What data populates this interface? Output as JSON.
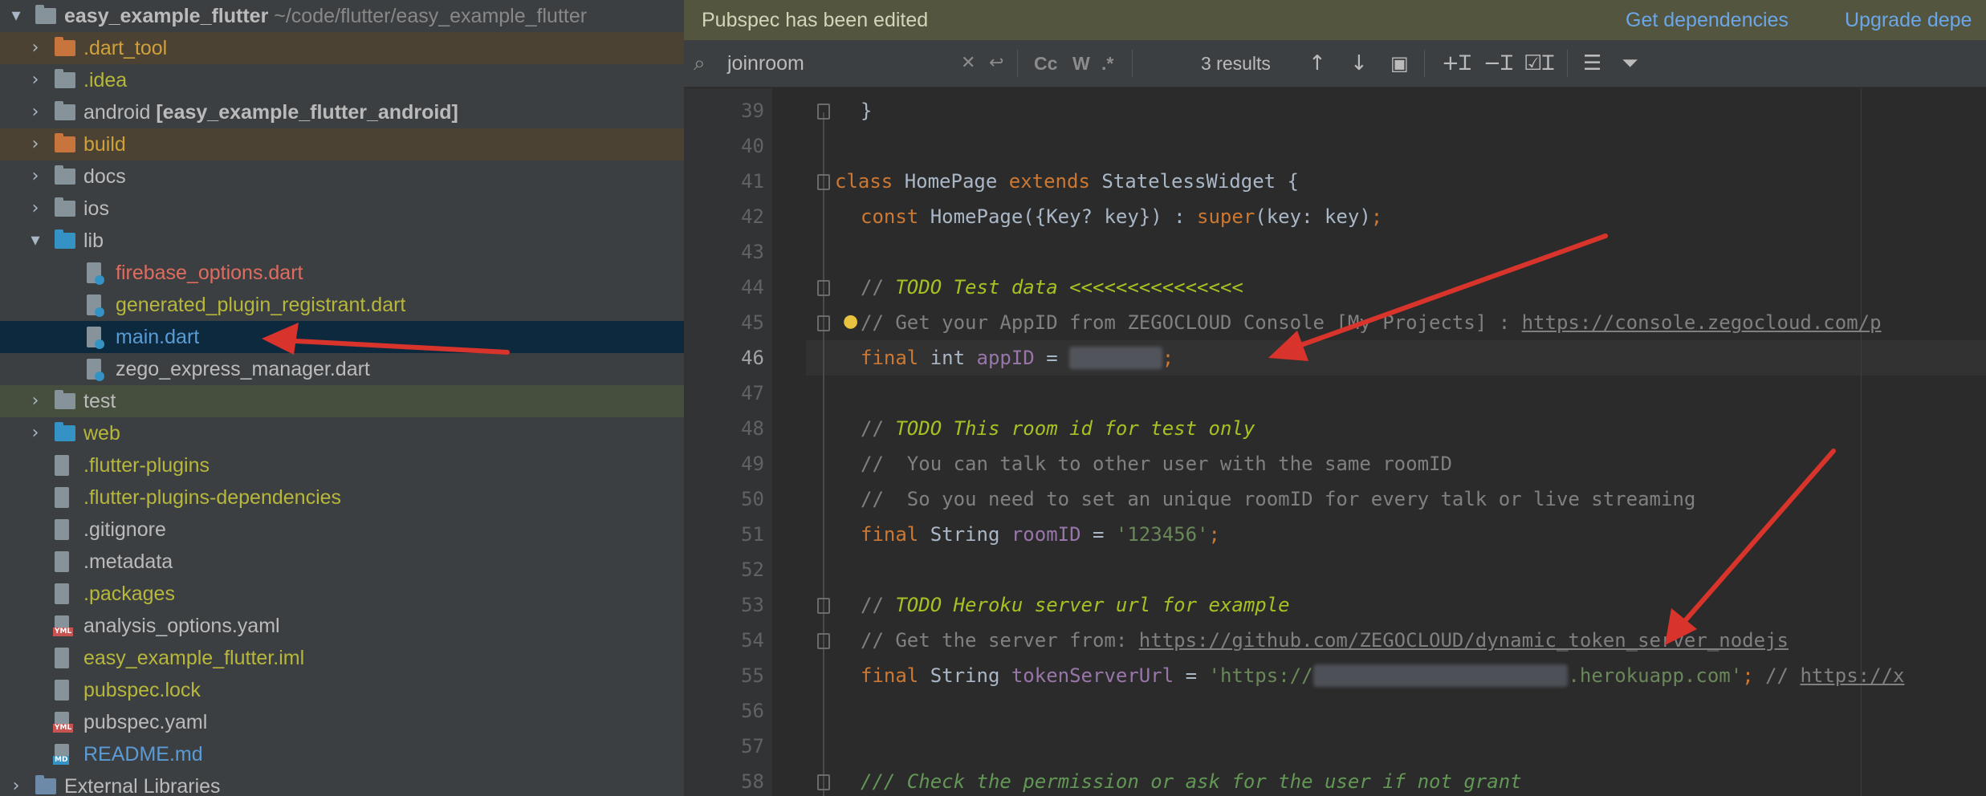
{
  "project_tree": {
    "items": [
      {
        "indent": 0,
        "arrow": "▾",
        "icon": "folder-icon",
        "label": "easy_example_flutter",
        "extra": "~/code/flutter/easy_example_flutter",
        "color": "white",
        "bold": true
      },
      {
        "indent": 1,
        "arrow": "›",
        "icon": "folder-icon",
        "label": ".dart_tool",
        "color": "orange",
        "bg": "brown"
      },
      {
        "indent": 1,
        "arrow": "›",
        "icon": "folder-icon",
        "label": ".idea",
        "color": "yellow"
      },
      {
        "indent": 1,
        "arrow": "›",
        "icon": "folder-icon",
        "label": "android",
        "extra": "[easy_example_flutter_android]",
        "color": "white"
      },
      {
        "indent": 1,
        "arrow": "›",
        "icon": "folder-icon",
        "label": "build",
        "color": "orange",
        "bg": "brown"
      },
      {
        "indent": 1,
        "arrow": "›",
        "icon": "folder-icon",
        "label": "docs",
        "color": "white"
      },
      {
        "indent": 1,
        "arrow": "›",
        "icon": "folder-icon",
        "label": "ios",
        "color": "white"
      },
      {
        "indent": 1,
        "arrow": "▾",
        "icon": "folder-icon",
        "label": "lib",
        "color": "white"
      },
      {
        "indent": 2,
        "icon": "dart-file-icon",
        "label": "firebase_options.dart",
        "color": "red"
      },
      {
        "indent": 2,
        "icon": "dart-file-icon",
        "label": "generated_plugin_registrant.dart",
        "color": "yellow"
      },
      {
        "indent": 2,
        "icon": "dart-file-icon",
        "label": "main.dart",
        "color": "blue",
        "selected": true
      },
      {
        "indent": 2,
        "icon": "dart-file-icon",
        "label": "zego_express_manager.dart",
        "color": "white"
      },
      {
        "indent": 1,
        "arrow": "›",
        "icon": "folder-icon",
        "label": "test",
        "color": "white",
        "bg": "green"
      },
      {
        "indent": 1,
        "arrow": "›",
        "icon": "folder-icon",
        "label": "web",
        "color": "yellow"
      },
      {
        "indent": 1,
        "icon": "file-icon",
        "label": ".flutter-plugins",
        "color": "yellow"
      },
      {
        "indent": 1,
        "icon": "file-icon",
        "label": ".flutter-plugins-dependencies",
        "color": "yellow"
      },
      {
        "indent": 1,
        "icon": "file-icon",
        "label": ".gitignore",
        "color": "white"
      },
      {
        "indent": 1,
        "icon": "file-icon",
        "label": ".metadata",
        "color": "white"
      },
      {
        "indent": 1,
        "icon": "file-icon",
        "label": ".packages",
        "color": "yellow"
      },
      {
        "indent": 1,
        "icon": "yaml-file-icon",
        "label": "analysis_options.yaml",
        "color": "white"
      },
      {
        "indent": 1,
        "icon": "file-icon",
        "label": "easy_example_flutter.iml",
        "color": "yellow"
      },
      {
        "indent": 1,
        "icon": "file-icon",
        "label": "pubspec.lock",
        "color": "yellow"
      },
      {
        "indent": 1,
        "icon": "yaml-file-icon",
        "label": "pubspec.yaml",
        "color": "white"
      },
      {
        "indent": 1,
        "icon": "markdown-file-icon",
        "label": "README.md",
        "color": "blue"
      },
      {
        "indent": 0,
        "arrow": "›",
        "icon": "library-icon",
        "label": "External Libraries",
        "color": "white"
      }
    ]
  },
  "banner": {
    "message": "Pubspec has been edited",
    "get_dependencies": "Get dependencies",
    "upgrade_dependencies": "Upgrade depe"
  },
  "find": {
    "query": "joinroom",
    "results": "3 results",
    "match_case": "Cc",
    "words": "W",
    "regex": ".*"
  },
  "editor": {
    "lines": [
      {
        "n": "39"
      },
      {
        "n": "40"
      },
      {
        "n": "41"
      },
      {
        "n": "42"
      },
      {
        "n": "43"
      },
      {
        "n": "44"
      },
      {
        "n": "45"
      },
      {
        "n": "46"
      },
      {
        "n": "47"
      },
      {
        "n": "48"
      },
      {
        "n": "49"
      },
      {
        "n": "50"
      },
      {
        "n": "51"
      },
      {
        "n": "52"
      },
      {
        "n": "53"
      },
      {
        "n": "54"
      },
      {
        "n": "55"
      },
      {
        "n": "56"
      },
      {
        "n": "57"
      },
      {
        "n": "58"
      }
    ],
    "code": {
      "l39": "}",
      "l41_kw1": "class",
      "l41_a": " HomePage ",
      "l41_kw2": "extends",
      "l41_b": " StatelessWidget {",
      "l42_kw": "const",
      "l42_a": " HomePage({Key? key}) : ",
      "l42_kw2": "super",
      "l42_b": "(key: key)",
      "l42_semi": ";",
      "l44_c": "// ",
      "l44_t": "TODO Test data <<<<<<<<<<<<<<<",
      "l45_c": "// Get your AppID from ZEGOCLOUD Console [My Projects] : ",
      "l45_u": "https://console.zegocloud.com/p",
      "l46_kw": "final",
      "l46_a": " int ",
      "l46_f": "appID",
      "l46_b": " = ",
      "l46_blur": "12345678",
      "l46_semi": ";",
      "l48_c": "// ",
      "l48_t": "TODO This room id for test only",
      "l49": "//  You can talk to other user with the same roomID",
      "l50": "//  So you need to set an unique roomID for every talk or live streaming",
      "l51_kw": "final",
      "l51_a": " String ",
      "l51_f": "roomID",
      "l51_b": " = ",
      "l51_s": "'123456'",
      "l51_semi": ";",
      "l53_c": "// ",
      "l53_t": "TODO Heroku server url for example",
      "l54_c": "// Get the server from: ",
      "l54_u": "https://github.com/ZEGOCLOUD/dynamic_token_server_nodejs",
      "l55_kw": "final",
      "l55_a": " String ",
      "l55_f": "tokenServerUrl",
      "l55_b": " = ",
      "l55_s1": "'https://",
      "l55_blur": "xxxxx-xxxxx-xxxxxxxx-1",
      "l55_s2": ".herokuapp.com'",
      "l55_semi": ";",
      "l55_c": " // ",
      "l55_u": "https://x",
      "l58": "/// Check the permission or ask for the user if not grant"
    }
  },
  "colors": {
    "annotation_arrow": "#d9342b",
    "selection": "#0d293e",
    "banner": "#54553f"
  }
}
